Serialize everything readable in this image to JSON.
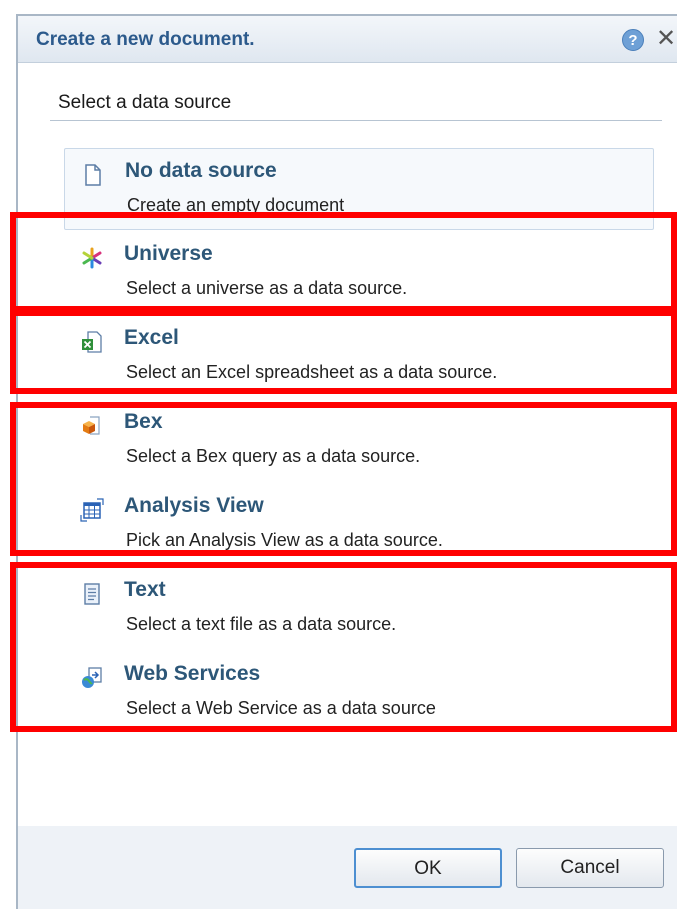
{
  "dialog": {
    "title": "Create a new document.",
    "help_icon": "help-icon",
    "close_icon": "close-icon",
    "help_glyph": "?",
    "close_glyph": "✕"
  },
  "section": {
    "label": "Select a data source"
  },
  "options": [
    {
      "label": "No data source",
      "description": "Create an empty document",
      "icon": "blank-document-icon",
      "selected": true
    },
    {
      "label": "Universe",
      "description": "Select a universe as a data source.",
      "icon": "universe-icon"
    },
    {
      "label": "Excel",
      "description": "Select an Excel spreadsheet as a data source.",
      "icon": "excel-icon"
    },
    {
      "label": "Bex",
      "description": "Select a Bex query as a data source.",
      "icon": "bex-cube-icon"
    },
    {
      "label": "Analysis View",
      "description": "Pick an Analysis View as a data source.",
      "icon": "analysis-view-grid-icon"
    },
    {
      "label": "Text",
      "description": "Select a text file as a data source.",
      "icon": "text-file-icon"
    },
    {
      "label": "Web Services",
      "description": "Select a Web Service as a data source",
      "icon": "web-services-globe-icon"
    }
  ],
  "buttons": {
    "ok": "OK",
    "cancel": "Cancel"
  },
  "colors": {
    "accent": "#2c5a8c",
    "highlight": "#ff0000",
    "option_label": "#2d5778"
  }
}
